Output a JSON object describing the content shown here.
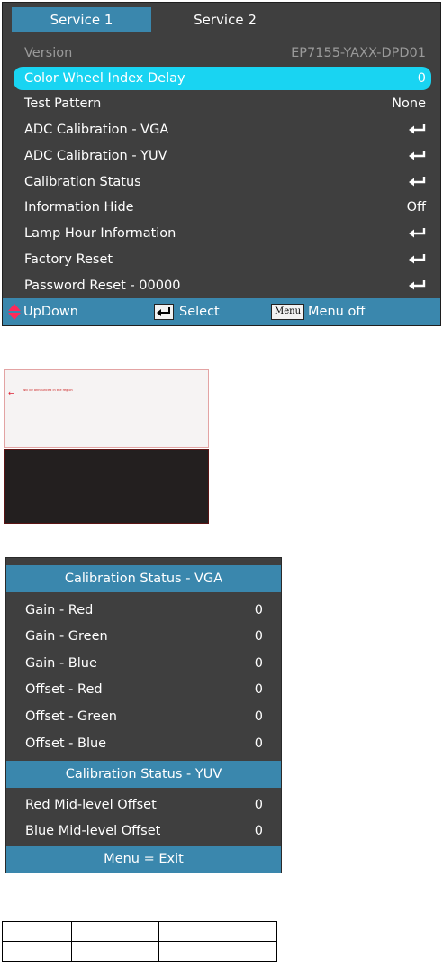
{
  "service_menu": {
    "tabs": [
      "Service 1",
      "Service 2"
    ],
    "rows": [
      {
        "label": "Version",
        "value": "EP7155-YAXX-DPD01"
      },
      {
        "label": "Color Wheel Index Delay",
        "value": "0"
      },
      {
        "label": "Test Pattern",
        "value": "None"
      },
      {
        "label": "ADC Calibration - VGA",
        "value": ""
      },
      {
        "label": "ADC Calibration - YUV",
        "value": ""
      },
      {
        "label": "Calibration Status",
        "value": ""
      },
      {
        "label": "Information Hide",
        "value": "Off"
      },
      {
        "label": "Lamp Hour Information",
        "value": ""
      },
      {
        "label": "Factory Reset",
        "value": ""
      },
      {
        "label": "Password Reset -  00000",
        "value": ""
      }
    ],
    "footer": {
      "updown": "UpDown",
      "select": "Select",
      "menu_key": "Menu",
      "menu_off": "Menu off"
    }
  },
  "thumbnail": {
    "caption": "Will be announced in the region"
  },
  "calibration_status": {
    "vga_title": "Calibration Status - VGA",
    "vga_rows": [
      {
        "label": "Gain - Red",
        "value": "0"
      },
      {
        "label": "Gain - Green",
        "value": "0"
      },
      {
        "label": "Gain - Blue",
        "value": "0"
      },
      {
        "label": "Offset - Red",
        "value": "0"
      },
      {
        "label": "Offset - Green",
        "value": "0"
      },
      {
        "label": "Offset - Blue",
        "value": "0"
      }
    ],
    "yuv_title": "Calibration Status - YUV",
    "yuv_rows": [
      {
        "label": "Red Mid-level Offset",
        "value": "0"
      },
      {
        "label": "Blue Mid-level Offset",
        "value": "0"
      }
    ],
    "footer": "Menu = Exit"
  },
  "colors": {
    "menu_bg": "#3f3f3f",
    "accent_blue": "#3a87ad",
    "highlight_cyan": "#19d4f2",
    "disabled_text": "#9a9a9a"
  },
  "icons": [
    "enter-icon",
    "updown-arrow-icon",
    "menu-key-icon",
    "red-arrow-icon"
  ]
}
